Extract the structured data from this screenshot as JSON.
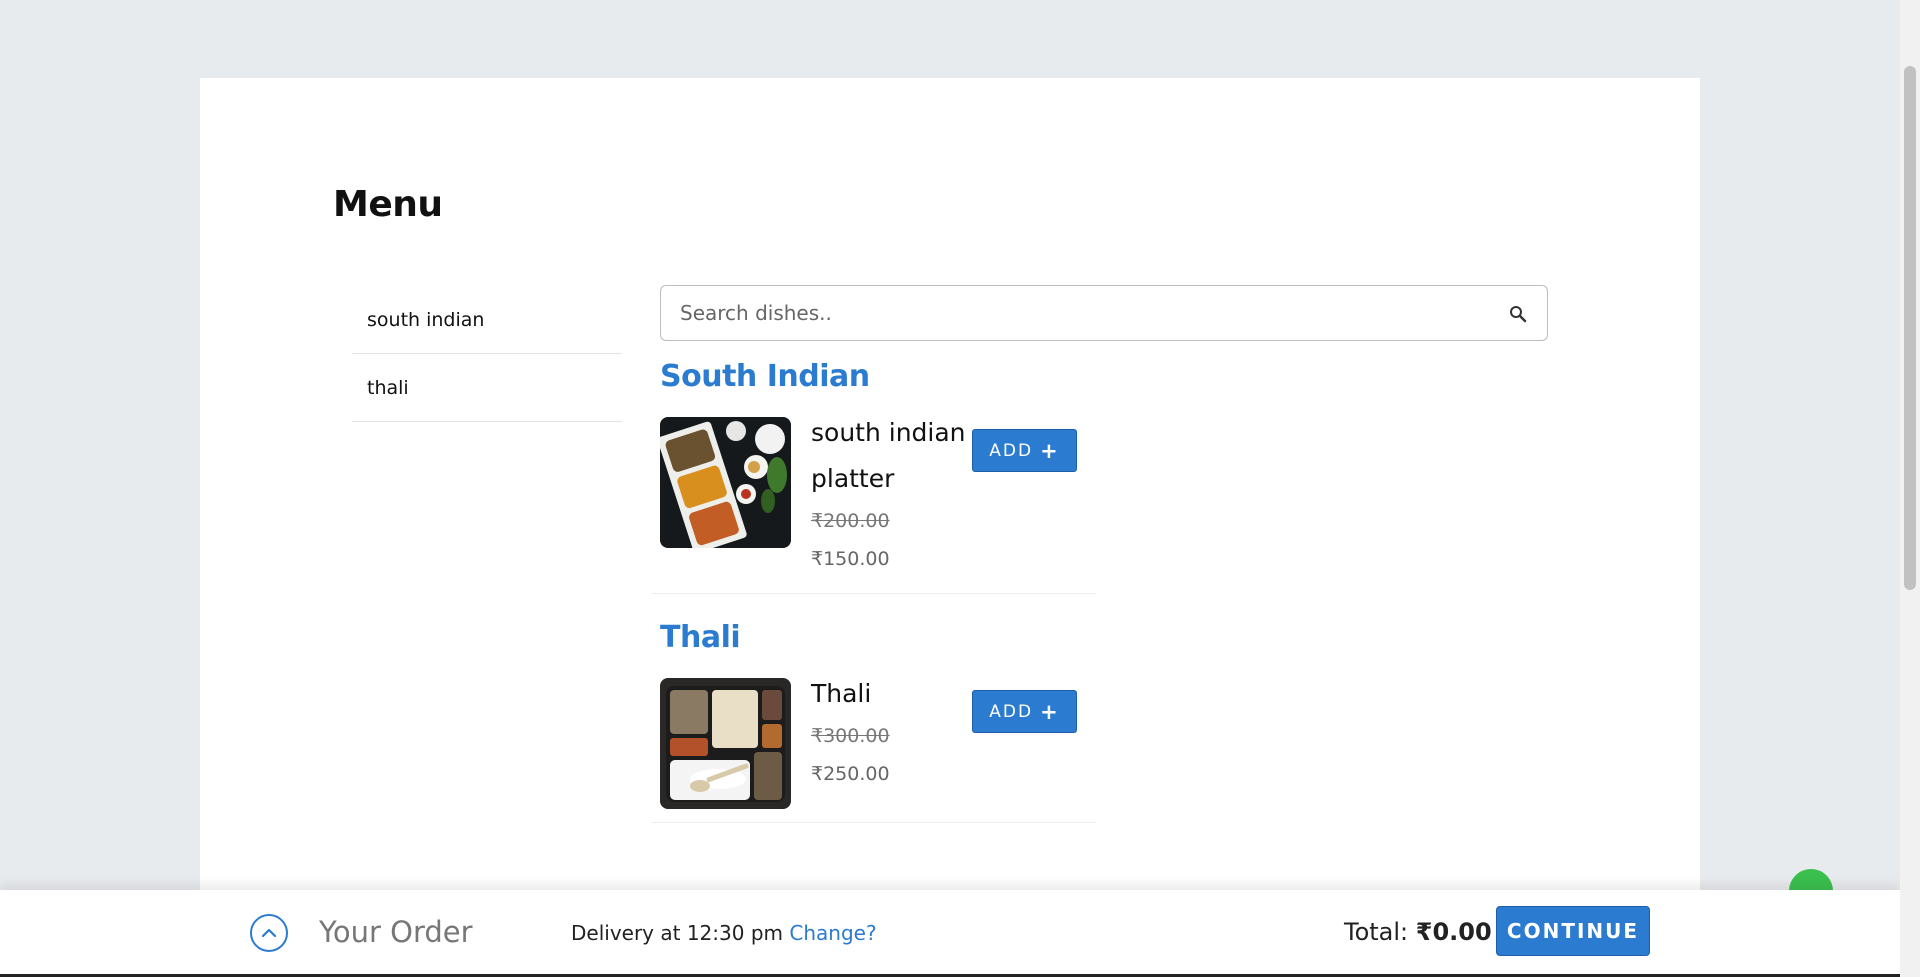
{
  "header": {
    "title": "Menu"
  },
  "sidebar": {
    "items": [
      {
        "label": "south indian"
      },
      {
        "label": "thali"
      }
    ]
  },
  "search": {
    "placeholder": "Search dishes..",
    "icon": "search-icon"
  },
  "categories": [
    {
      "title": "South Indian",
      "dishes": [
        {
          "name": "south indian platter",
          "old_price": "₹200.00",
          "price": "₹150.00",
          "add_label": "ADD",
          "add_icon": "+"
        }
      ]
    },
    {
      "title": "Thali",
      "dishes": [
        {
          "name": "Thali",
          "old_price": "₹300.00",
          "price": "₹250.00",
          "add_label": "ADD",
          "add_icon": "+"
        }
      ]
    }
  ],
  "footer": {
    "your_order": "Your Order",
    "delivery_text": "Delivery at 12:30 pm",
    "change_link": "Change?",
    "total_label": "Total:",
    "total_amount": "₹0.00",
    "continue_label": "CONTINUE"
  },
  "colors": {
    "accent": "#2b7bd0",
    "background": "#e8ebee",
    "whatsapp": "#3bbf4e"
  }
}
